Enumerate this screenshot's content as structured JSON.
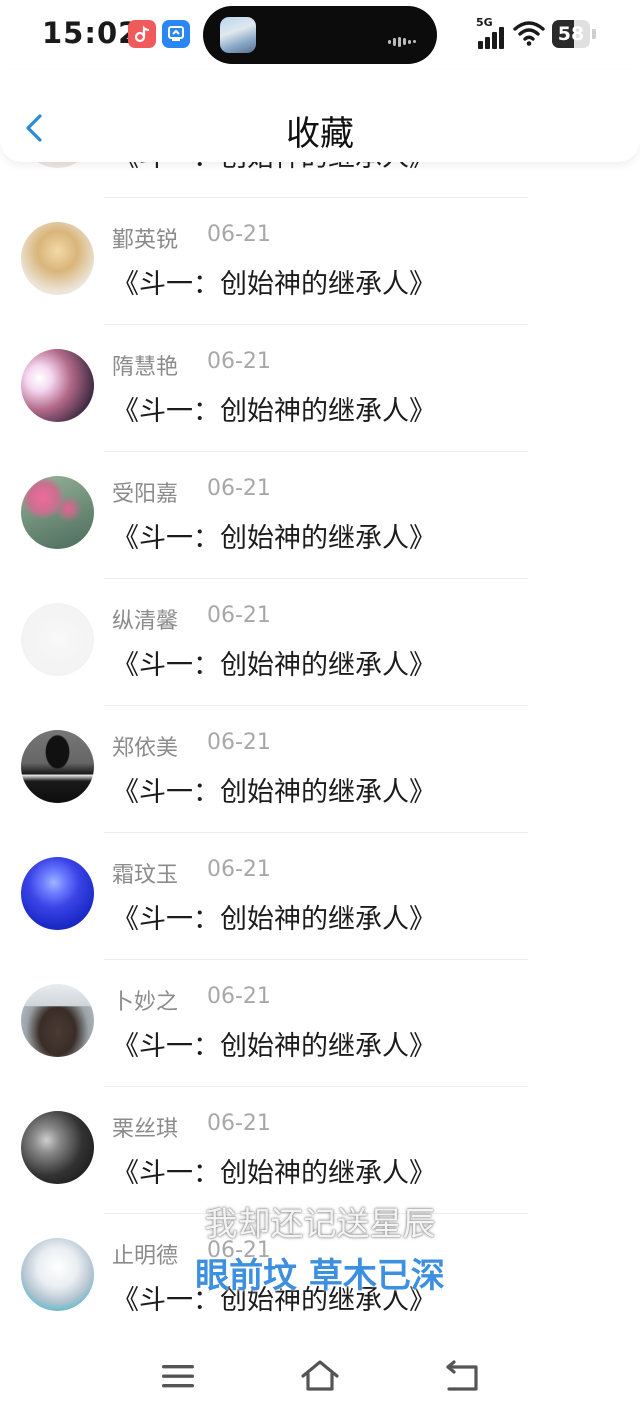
{
  "status_bar": {
    "time": "15:02",
    "network": "5G",
    "battery": "58",
    "battery_fraction": 0.58
  },
  "header": {
    "title": "收藏"
  },
  "list": {
    "partial_top_item": {
      "title": "《斗一：创始神的继承人》"
    },
    "items": [
      {
        "username": "鄞英锐",
        "date": "06-21",
        "title": "《斗一：创始神的继承人》",
        "avatar": "anime-boy-avatar"
      },
      {
        "username": "隋慧艳",
        "date": "06-21",
        "title": "《斗一：创始神的继承人》",
        "avatar": "girl-photo-avatar"
      },
      {
        "username": "受阳嘉",
        "date": "06-21",
        "title": "《斗一：创始神的继承人》",
        "avatar": "flowers-avatar"
      },
      {
        "username": "纵清馨",
        "date": "06-21",
        "title": "《斗一：创始神的继承人》",
        "avatar": "text-avatar"
      },
      {
        "username": "郑依美",
        "date": "06-21",
        "title": "《斗一：创始神的继承人》",
        "avatar": "bw-figure-avatar"
      },
      {
        "username": "霜玟玉",
        "date": "06-21",
        "title": "《斗一：创始神的继承人》",
        "avatar": "jellyfish-avatar"
      },
      {
        "username": "卜妙之",
        "date": "06-21",
        "title": "《斗一：创始神的继承人》",
        "avatar": "pagoda-avatar"
      },
      {
        "username": "栗丝琪",
        "date": "06-21",
        "title": "《斗一：创始神的继承人》",
        "avatar": "smoke-avatar"
      },
      {
        "username": "止明德",
        "date": "06-21",
        "title": "《斗一：创始神的继承人》",
        "avatar": "anime-girl-avatar"
      }
    ]
  },
  "subtitle": {
    "line1": "我却还记送星辰",
    "line2": "眼前坟 草木已深"
  },
  "nav_bar": {
    "buttons": [
      "menu-icon",
      "home-icon",
      "back-icon"
    ]
  },
  "colors": {
    "accent": "#2a8bdc",
    "subtitle_blue": "#3d8fe0"
  }
}
